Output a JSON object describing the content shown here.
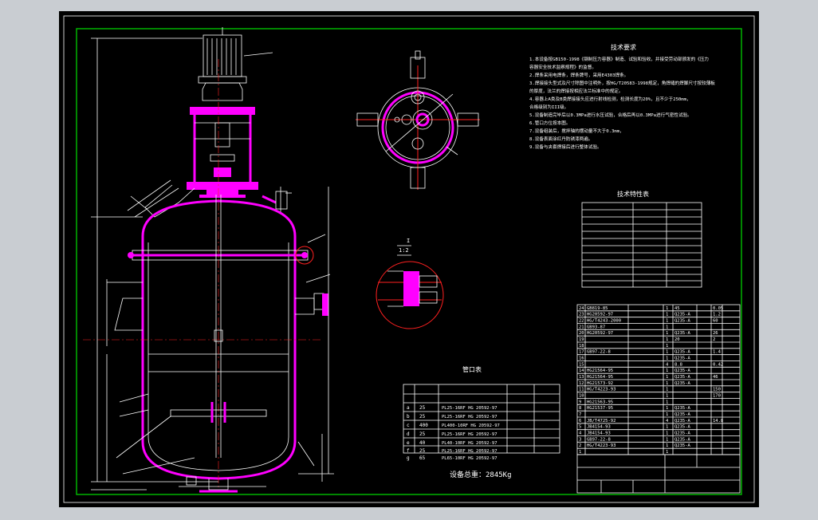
{
  "tech_requirements": {
    "title": "技术要求",
    "lines": [
      "1.本设备按GB150-1998《钢制压力容器》制造、试验和验收，并接受劳动部颁发的《压力",
      "容器安全技术监察规程》的监督。",
      "2.焊条采用电焊条，焊条牌号，采用E4303焊条。",
      "3.焊接接头型式及尺寸除图中注明外，按HG/T20583-1998规定，角焊缝的焊脚尺寸按较薄板",
      "的厚度，法兰的焊接按相应法兰标准中的规定。",
      "4.容器上A类及B类焊接接头应进行射线检测，检测长度为20%，且不少于250mm，",
      "合格级别为III级。",
      "5.设备制造完毕后以0.3MPa进行水压试验，合格后再以0.3MPa进行气密性试验。",
      "6.管口方位按本图。",
      "7.设备组装后，搅拌轴的摆动量不大于0.3mm，",
      "8.设备表面涂红丹防锈漆两遍。",
      "9.设备与夹套焊接后进行整体试验。"
    ]
  },
  "tech_spec_table": {
    "title": "技术特性表",
    "rows": 12
  },
  "nozzle_table": {
    "title": "管口表",
    "rows": [
      {
        "mark": "a",
        "dn": "25",
        "spec": "PL25-16RF HG 20592-97"
      },
      {
        "mark": "b",
        "dn": "25",
        "spec": "PL25-16RF HG 20592-97"
      },
      {
        "mark": "c",
        "dn": "400",
        "spec": "PL400-10RF HG 20592-97"
      },
      {
        "mark": "d",
        "dn": "25",
        "spec": "PL25-16RF HG 20592-97"
      },
      {
        "mark": "e",
        "dn": "40",
        "spec": "PL40-10RF HG 20592-97"
      },
      {
        "mark": "f",
        "dn": "25",
        "spec": "PL25-16RF HG 20592-97"
      },
      {
        "mark": "g",
        "dn": "65",
        "spec": "PL65-10RF HG 20592-97"
      }
    ]
  },
  "detail_view": {
    "label": "I",
    "scale": "1:2"
  },
  "total_weight": "设备总重：2845Kg",
  "parts_list": {
    "rows": [
      {
        "no": "24",
        "code": "GB819-85",
        "qty": "1",
        "mat": "45",
        "w": "0.05"
      },
      {
        "no": "23",
        "code": "HG20592-97",
        "qty": "1",
        "mat": "Q235-A",
        "w": "1.2"
      },
      {
        "no": "22",
        "code": "HG/T4243-2000",
        "qty": "1",
        "mat": "Q235-A",
        "w": "60"
      },
      {
        "no": "21",
        "code": "GB93-87",
        "qty": "1",
        "mat": "",
        "w": ""
      },
      {
        "no": "20",
        "code": "HG20592-97",
        "qty": "1",
        "mat": "Q235-A",
        "w": "26"
      },
      {
        "no": "19",
        "code": "",
        "qty": "1",
        "mat": "20",
        "w": "2"
      },
      {
        "no": "18",
        "code": "",
        "qty": "1",
        "mat": "",
        "w": ""
      },
      {
        "no": "17",
        "code": "GB97-22-8",
        "qty": "1",
        "mat": "Q235-A",
        "w": "1.4"
      },
      {
        "no": "16",
        "code": "",
        "qty": "1",
        "mat": "Q235-A",
        "w": ""
      },
      {
        "no": "15",
        "code": "",
        "qty": "4",
        "mat": "8.8",
        "w": "0.42"
      },
      {
        "no": "14",
        "code": "HG21564-95",
        "qty": "1",
        "mat": "Q235-A",
        "w": ""
      },
      {
        "no": "13",
        "code": "HG21564-95",
        "qty": "1",
        "mat": "Q235-A",
        "w": "46"
      },
      {
        "no": "12",
        "code": "HG21573-92",
        "qty": "1",
        "mat": "Q235-A",
        "w": ""
      },
      {
        "no": "11",
        "code": "HG/T4223-93",
        "qty": "1",
        "mat": "",
        "w": "150"
      },
      {
        "no": "10",
        "code": "",
        "qty": "1",
        "mat": "",
        "w": "170"
      },
      {
        "no": "9",
        "code": "HG21563-95",
        "qty": "1",
        "mat": "",
        "w": ""
      },
      {
        "no": "8",
        "code": "HG21537-95",
        "qty": "1",
        "mat": "Q235-A",
        "w": ""
      },
      {
        "no": "7",
        "code": "",
        "qty": "1",
        "mat": "Q235-A",
        "w": ""
      },
      {
        "no": "6",
        "code": "JB/T4725-92",
        "qty": "4",
        "mat": "Q235-A",
        "w": "14.8"
      },
      {
        "no": "5",
        "code": "JB4154-93",
        "qty": "1",
        "mat": "Q235-A",
        "w": ""
      },
      {
        "no": "4",
        "code": "JB4154-93",
        "qty": "1",
        "mat": "Q235-A",
        "w": ""
      },
      {
        "no": "3",
        "code": "GB97-22-8",
        "qty": "1",
        "mat": "Q235-A",
        "w": ""
      },
      {
        "no": "2",
        "code": "HG/T4223-93",
        "qty": "1",
        "mat": "Q235-A",
        "w": ""
      },
      {
        "no": "1",
        "code": "",
        "qty": "1",
        "mat": "",
        "w": ""
      }
    ]
  },
  "colors": {
    "background": "#000000",
    "line": "#ffffff",
    "vessel": "#ff00ff",
    "centerline": "#ff2020",
    "frame": "#00c000"
  }
}
